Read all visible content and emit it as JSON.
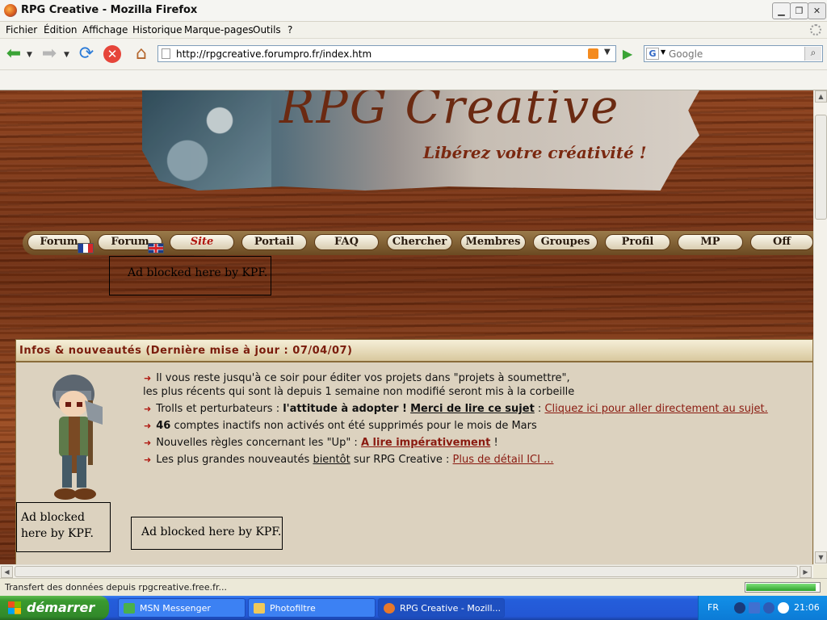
{
  "window": {
    "title": "RPG Creative - Mozilla Firefox"
  },
  "menu": [
    "Fichier",
    "Édition",
    "Affichage",
    "Historique",
    "Marque-pages",
    "Outils",
    "?"
  ],
  "address": {
    "url": "http://rpgcreative.forumpro.fr/index.htm"
  },
  "search": {
    "placeholder": "Google"
  },
  "banner": {
    "title": "RPG Creative",
    "slogan": "Libérez votre créativité !"
  },
  "nav": [
    "Forum",
    "Forum",
    "Site",
    "Portail",
    "FAQ",
    "Chercher",
    "Membres",
    "Groupes",
    "Profil",
    "MP",
    "Off"
  ],
  "ads": {
    "top": "Ad blocked here by KPF.",
    "left": "Ad blocked here by KPF.",
    "bottom": "Ad blocked here by KPF."
  },
  "info": {
    "header": "Infos & nouveautés (Dernière mise à jour : 07/04/07)",
    "item1": {
      "line1": "Il vous reste jusqu'à ce soir pour éditer vos projets dans \"projets à soumettre\",",
      "line2": "les plus récents qui sont là depuis 1 semaine non modifié seront mis à la corbeille"
    },
    "item2": {
      "pre": "Trolls et perturbateurs : ",
      "bold": "l'attitude à adopter !",
      "link1": "Merci de lire ce sujet",
      "sep": " : ",
      "link2": "Cliquez ici pour aller directement au sujet."
    },
    "item3": {
      "count": "46",
      "text": " comptes inactifs non activés ont été supprimés pour le mois de Mars"
    },
    "item4": {
      "pre": "Nouvelles règles concernant les \"Up\" : ",
      "link": "A lire impérativement",
      "post": " !"
    },
    "item5": {
      "pre": "Les plus grandes nouveautés ",
      "under": "bientôt",
      "mid": " sur RPG Creative : ",
      "link": "Plus de détail ICI ..."
    }
  },
  "status": {
    "text": "Transfert des données depuis rpgcreative.free.fr...",
    "progress": 0.95
  },
  "taskbar": {
    "start": "démarrer",
    "tasks": [
      "MSN Messenger",
      "Photofiltre",
      "RPG Creative - Mozill..."
    ],
    "lang": "FR",
    "clock": "21:06"
  },
  "colors": {
    "accent_red": "#8a1a10",
    "wood": "#7a3414"
  }
}
